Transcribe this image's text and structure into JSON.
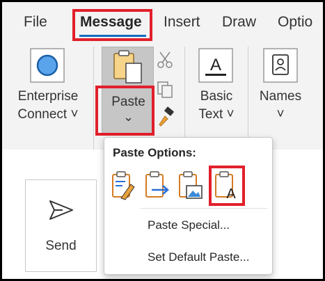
{
  "tabs": [
    {
      "label": "File"
    },
    {
      "label": "Message",
      "active": true
    },
    {
      "label": "Insert"
    },
    {
      "label": "Draw"
    },
    {
      "label": "Optio"
    }
  ],
  "ribbon": {
    "enterprise_connect": {
      "line1": "Enterprise",
      "line2": "Connect ˅",
      "icon": "enterprise-connect-icon"
    },
    "paste": {
      "label": "Paste",
      "chevron": "⌄",
      "icon": "clipboard-paste-icon"
    },
    "cut_icon": "scissors-icon",
    "copy_icon": "copy-icon",
    "format_painter_icon": "format-painter-icon",
    "basic_text": {
      "line1": "Basic",
      "line2": "Text ˅",
      "icon": "font-a-icon"
    },
    "names": {
      "line1": "Names",
      "line2": "˅",
      "icon": "address-book-icon"
    }
  },
  "paste_menu": {
    "title": "Paste Options:",
    "options": [
      {
        "icon": "keep-source-formatting-icon"
      },
      {
        "icon": "merge-formatting-icon"
      },
      {
        "icon": "picture-paste-icon"
      },
      {
        "icon": "keep-text-only-icon",
        "highlighted": true
      }
    ],
    "items": [
      {
        "label": "Paste Special..."
      },
      {
        "label": "Set Default Paste..."
      }
    ]
  },
  "send": {
    "label": "Send",
    "icon": "send-arrow-icon"
  },
  "colors": {
    "accent": "#0f6cbd",
    "highlight": "#e1202b",
    "orange": "#d47b22"
  }
}
